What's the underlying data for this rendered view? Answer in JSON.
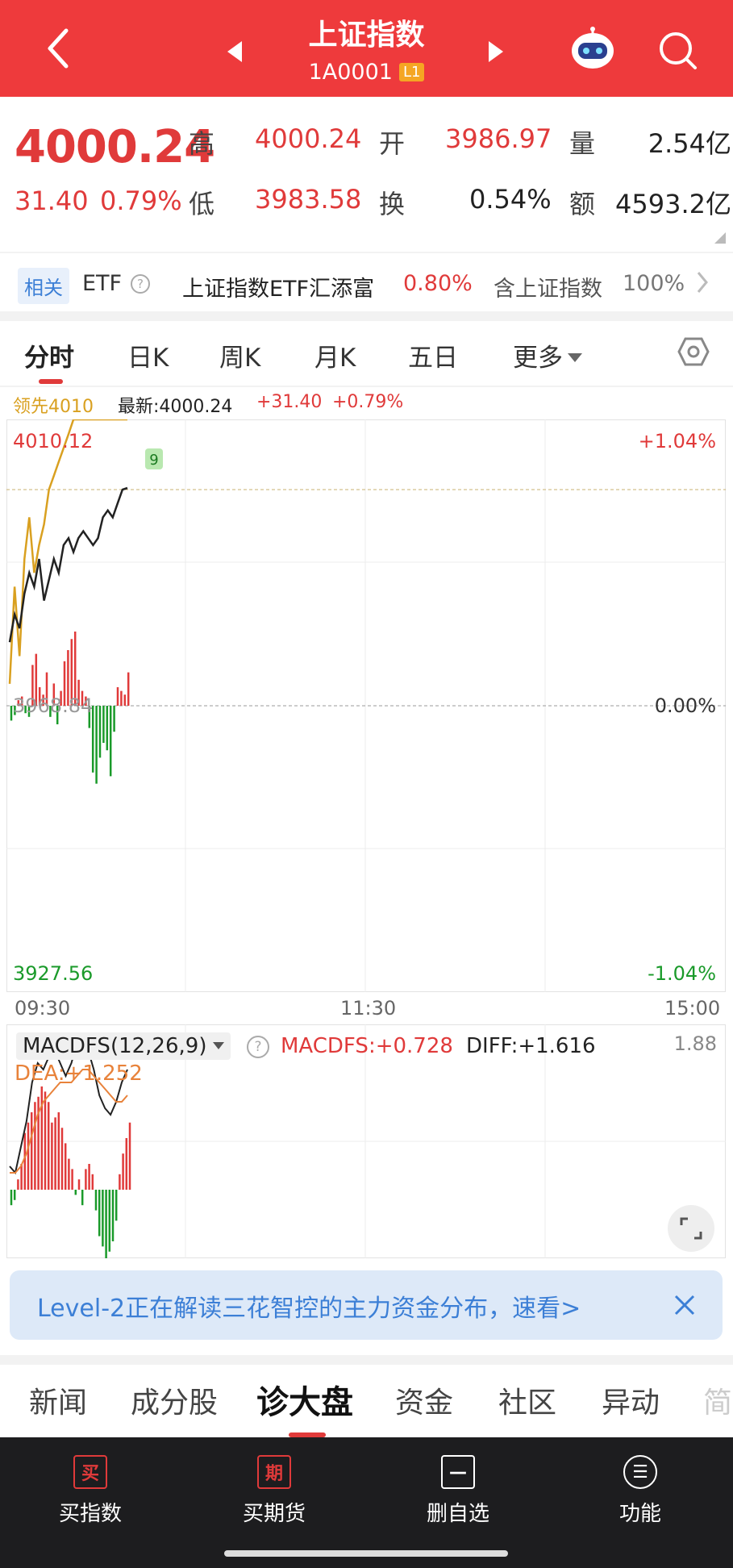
{
  "header": {
    "title": "上证指数",
    "code": "1A0001",
    "level_badge": "L1",
    "icons": [
      "back-icon",
      "prev-arrow-icon",
      "next-arrow-icon",
      "robot-assistant-icon",
      "search-icon"
    ]
  },
  "quote": {
    "price": "4000.24",
    "change": "31.40",
    "change_pct": "0.79%",
    "high_label": "高",
    "high": "4000.24",
    "open_label": "开",
    "open": "3986.97",
    "volume_label": "量",
    "volume": "2.54亿",
    "low_label": "低",
    "low": "3983.58",
    "turnover_label": "换",
    "turnover": "0.54%",
    "amount_label": "额",
    "amount": "4593.2亿"
  },
  "etf": {
    "tag": "相关",
    "label": "ETF",
    "help_icon": "help-circle-icon",
    "name": "上证指数ETF汇添富",
    "pct": "0.80%",
    "contain": "含上证指数",
    "weight": "100%"
  },
  "tabs": [
    "分时",
    "日K",
    "周K",
    "月K",
    "五日",
    "更多"
  ],
  "info": {
    "leader": "领先4010",
    "latest": "最新:4000.24",
    "change": "+31.40",
    "pct": "+0.79%"
  },
  "chart_labels": {
    "top_price": "4010.12",
    "top_pct": "+1.04%",
    "mid_price": "3968.84",
    "mid_pct": "0.00%",
    "bottom_price": "3927.56",
    "bottom_pct": "-1.04%",
    "marker": "9",
    "times": [
      "09:30",
      "11:30",
      "15:00"
    ]
  },
  "chart_data": {
    "type": "line",
    "ylim": [
      3927.56,
      4010.12
    ],
    "series": [
      {
        "name": "最新",
        "color": "#222222",
        "values": [
          3978,
          3982,
          3980,
          3985,
          3988,
          3986,
          3990,
          3984,
          3987,
          3990,
          3988,
          3992,
          3993,
          3991,
          3993,
          3994,
          3993,
          3992,
          3993,
          3996,
          3997,
          3996,
          3998,
          4000,
          4000.24
        ]
      },
      {
        "name": "领先",
        "color": "#d9a020",
        "values": [
          3972,
          3986,
          3976,
          3990,
          3996,
          3988,
          3992,
          3995,
          4000,
          4002,
          4004,
          4006,
          4008,
          4012,
          4014,
          4016,
          4018,
          4017,
          4019,
          4020,
          4020,
          4019,
          4020,
          4020,
          4020
        ]
      }
    ],
    "volume_bars": [
      -8,
      -5,
      3,
      5,
      -4,
      -6,
      22,
      28,
      10,
      6,
      18,
      -6,
      12,
      -10,
      8,
      24,
      30,
      36,
      40,
      14,
      8,
      5,
      -12,
      -36,
      -42,
      -28,
      -20,
      -24,
      -38,
      -14,
      10,
      8,
      6,
      18
    ]
  },
  "macd": {
    "name": "MACDFS(12,26,9)",
    "help_icon": "help-circle-icon",
    "macdfs": "MACDFS:+0.728",
    "diff": "DIFF:+1.616",
    "dea": "DEA:+1.252",
    "top_value": "1.88",
    "expand_icon": "expand-icon",
    "bars": [
      -6,
      -4,
      4,
      10,
      22,
      26,
      30,
      34,
      36,
      40,
      38,
      34,
      26,
      28,
      30,
      24,
      18,
      12,
      8,
      -2,
      4,
      -6,
      8,
      10,
      6,
      -8,
      -18,
      -22,
      -28,
      -24,
      -20,
      -12,
      6,
      14,
      20,
      26
    ],
    "diff_line": [
      0.3,
      0.2,
      0.6,
      1.0,
      1.6,
      1.9,
      1.8,
      2.0,
      2.1,
      1.9,
      1.7,
      1.9,
      2.2,
      2.3,
      2.1,
      1.8,
      1.4,
      1.2,
      1.1,
      1.3,
      1.6,
      1.8
    ],
    "dea_line": [
      0.2,
      0.2,
      0.3,
      0.5,
      0.8,
      1.1,
      1.3,
      1.4,
      1.5,
      1.6,
      1.6,
      1.6,
      1.7,
      1.8,
      1.8,
      1.7,
      1.6,
      1.5,
      1.4,
      1.3,
      1.3,
      1.4
    ]
  },
  "banner": {
    "text": "Level-2正在解读三花智控的主力资金分布，速看>",
    "close_icon": "close-icon"
  },
  "bottom_tabs": [
    "新闻",
    "成分股",
    "诊大盘",
    "资金",
    "社区",
    "异动",
    "简"
  ],
  "nav": [
    {
      "label": "买指数",
      "icon_text": "买"
    },
    {
      "label": "买期货",
      "icon_text": "期"
    },
    {
      "label": "删自选",
      "icon_text": "—"
    },
    {
      "label": "功能",
      "icon_text": "☰"
    }
  ]
}
